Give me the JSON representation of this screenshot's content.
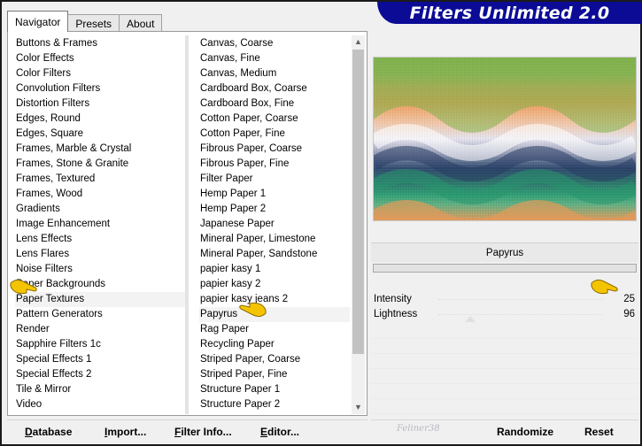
{
  "banner": {
    "title": "Filters Unlimited 2.0"
  },
  "tabs": [
    {
      "label": "Navigator",
      "active": true
    },
    {
      "label": "Presets",
      "active": false
    },
    {
      "label": "About",
      "active": false
    }
  ],
  "categories": [
    "Buttons & Frames",
    "Color Effects",
    "Color Filters",
    "Convolution Filters",
    "Distortion Filters",
    "Edges, Round",
    "Edges, Square",
    "Frames, Marble & Crystal",
    "Frames, Stone & Granite",
    "Frames, Textured",
    "Frames, Wood",
    "Gradients",
    "Image Enhancement",
    "Lens Effects",
    "Lens Flares",
    "Noise Filters",
    "Paper Backgrounds",
    "Paper Textures",
    "Pattern Generators",
    "Render",
    "Sapphire Filters 1c",
    "Special Effects 1",
    "Special Effects 2",
    "Tile & Mirror",
    "Video"
  ],
  "selected_category": "Paper Textures",
  "filters": [
    "Canvas, Coarse",
    "Canvas, Fine",
    "Canvas, Medium",
    "Cardboard Box, Coarse",
    "Cardboard Box, Fine",
    "Cotton Paper, Coarse",
    "Cotton Paper, Fine",
    "Fibrous Paper, Coarse",
    "Fibrous Paper, Fine",
    "Filter Paper",
    "Hemp Paper 1",
    "Hemp Paper 2",
    "Japanese Paper",
    "Mineral Paper, Limestone",
    "Mineral Paper, Sandstone",
    "papier kasy 1",
    "papier kasy 2",
    "papier kasy jeans 2",
    "Papyrus",
    "Rag Paper",
    "Recycling Paper",
    "Striped Paper, Coarse",
    "Striped Paper, Fine",
    "Structure Paper 1",
    "Structure Paper 2"
  ],
  "selected_filter": "Papyrus",
  "filter_name": "Papyrus",
  "params": [
    {
      "label": "Intensity",
      "value": "25"
    },
    {
      "label": "Lightness",
      "value": "96"
    }
  ],
  "buttons": {
    "database": "Database",
    "import": "Import...",
    "filter_info": "Filter Info...",
    "editor": "Editor...",
    "randomize": "Randomize",
    "reset": "Reset"
  },
  "watermark": "Feliner38",
  "icons": {
    "scroll_up": "chevron-up-icon",
    "scroll_down": "chevron-down-icon",
    "pointer": "pointing-hand-icon"
  },
  "colors": {
    "banner_bg": "#0b0b96",
    "banner_text": "#ffffff",
    "hand_yellow": "#f5c400"
  }
}
